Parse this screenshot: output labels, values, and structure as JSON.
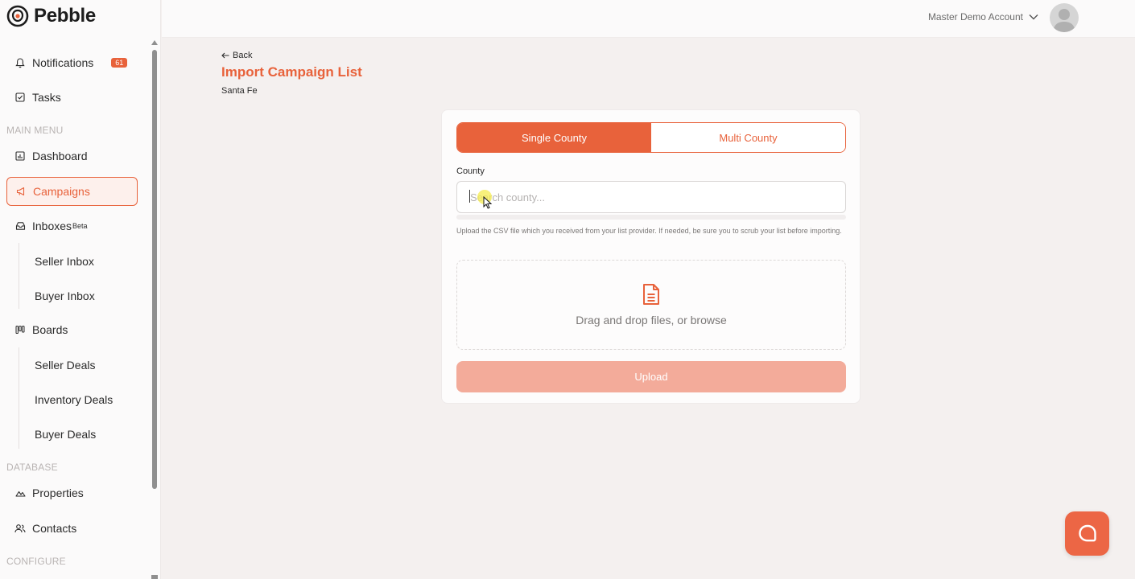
{
  "app": {
    "name": "Pebble"
  },
  "header": {
    "account_name": "Master Demo Account"
  },
  "sidebar": {
    "notifications": {
      "label": "Notifications",
      "count": "61"
    },
    "tasks": {
      "label": "Tasks"
    },
    "section_main": "MAIN MENU",
    "dashboard": {
      "label": "Dashboard"
    },
    "campaigns": {
      "label": "Campaigns"
    },
    "inboxes": {
      "label": "Inboxes",
      "tag": "Beta",
      "children": [
        "Seller Inbox",
        "Buyer Inbox"
      ]
    },
    "boards": {
      "label": "Boards",
      "children": [
        "Seller Deals",
        "Inventory Deals",
        "Buyer Deals"
      ]
    },
    "section_database": "DATABASE",
    "properties": {
      "label": "Properties"
    },
    "contacts": {
      "label": "Contacts"
    },
    "section_configure": "CONFIGURE"
  },
  "page": {
    "back_label": "Back",
    "title": "Import Campaign List",
    "subtitle": "Santa Fe"
  },
  "form": {
    "tabs": {
      "single": "Single County",
      "multi": "Multi County",
      "active": "single"
    },
    "county_label": "County",
    "county_placeholder": "Search county...",
    "helper_text": "Upload the CSV file which you received from your list provider. If needed, be sure you to scrub your list before importing.",
    "dropzone_text": "Drag and drop files, or browse",
    "upload_label": "Upload"
  },
  "colors": {
    "accent": "#e8623b",
    "upload_disabled": "#f3ab9a"
  }
}
